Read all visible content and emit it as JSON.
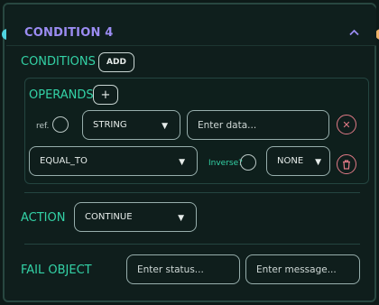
{
  "header": {
    "title": "CONDITION 4",
    "collapse_icon": "chevron-up-icon"
  },
  "conditions": {
    "label": "CONDITIONS",
    "add_label": "ADD"
  },
  "operands": {
    "label": "OPERANDS",
    "add_label": "+",
    "row1": {
      "ref_label": "ref.",
      "type_value": "STRING",
      "data_placeholder": "Enter data...",
      "remove_icon": "close-icon"
    },
    "row2": {
      "operator_value": "EQUAL_TO",
      "inverse_label": "Inverse?",
      "modifier_value": "NONE",
      "delete_icon": "trash-icon"
    }
  },
  "action": {
    "label": "ACTION",
    "value": "CONTINUE"
  },
  "fail_object": {
    "label": "FAIL OBJECT",
    "status_placeholder": "Enter status...",
    "message_placeholder": "Enter message..."
  },
  "colors": {
    "accent_purple": "#9b8cf2",
    "accent_green": "#33d2a6",
    "danger": "#e07a86",
    "handle_left": "#4fd3e0",
    "handle_right": "#f0b36a"
  }
}
